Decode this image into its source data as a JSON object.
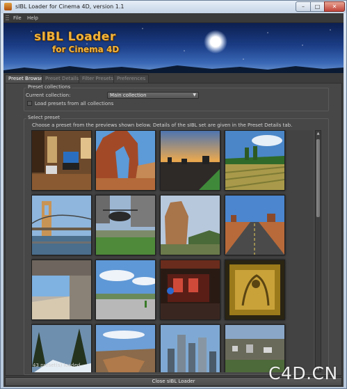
{
  "window": {
    "title": "sIBL Loader for Cinema 4D, version 1.1",
    "controls": {
      "minimize": "–",
      "maximize": "□",
      "close": "✕"
    }
  },
  "menu": {
    "items": [
      "File",
      "Help"
    ]
  },
  "banner": {
    "title": "sIBL Loader",
    "subtitle": "for Cinema 4D"
  },
  "tabs": [
    {
      "label": "Preset Browser",
      "active": true
    },
    {
      "label": "Preset Details",
      "active": false
    },
    {
      "label": "Filter Presets",
      "active": false
    },
    {
      "label": "Preferences",
      "active": false
    }
  ],
  "preset_collections": {
    "title": "Preset collections",
    "current_label": "Current collection:",
    "current_value": "Main collection",
    "load_all_label": "Load presets from all collections",
    "load_all_checked": false
  },
  "select_preset": {
    "title": "Select preset",
    "instructions": "Choose a preset from the previews shown below. Details of the sIBL set are given in the Preset Details tab.",
    "thumbnails": [
      {
        "name": "living-room-thumbnail"
      },
      {
        "name": "red-rock-arch-thumbnail"
      },
      {
        "name": "city-sunset-thumbnail"
      },
      {
        "name": "green-field-thumbnail"
      },
      {
        "name": "bridge-thumbnail"
      },
      {
        "name": "helicopter-thumbnail"
      },
      {
        "name": "rock-formation-thumbnail"
      },
      {
        "name": "desert-road-thumbnail"
      },
      {
        "name": "concrete-interior-thumbnail"
      },
      {
        "name": "skatepark-thumbnail"
      },
      {
        "name": "red-interior-thumbnail"
      },
      {
        "name": "carved-panel-thumbnail"
      },
      {
        "name": "snowy-forest-thumbnail"
      },
      {
        "name": "canyon-thumbnail"
      },
      {
        "name": "skyline-thumbnail"
      },
      {
        "name": "aerial-city-thumbnail"
      }
    ]
  },
  "status": {
    "presets_loaded": "43 preset(s) loaded"
  },
  "footer": {
    "close_label": "Close sIBL Loader"
  },
  "watermark": "C4D.CN",
  "colors": {
    "accent": "#f2b33a",
    "panel": "#474747",
    "titlebar": "#c5d4e6"
  }
}
